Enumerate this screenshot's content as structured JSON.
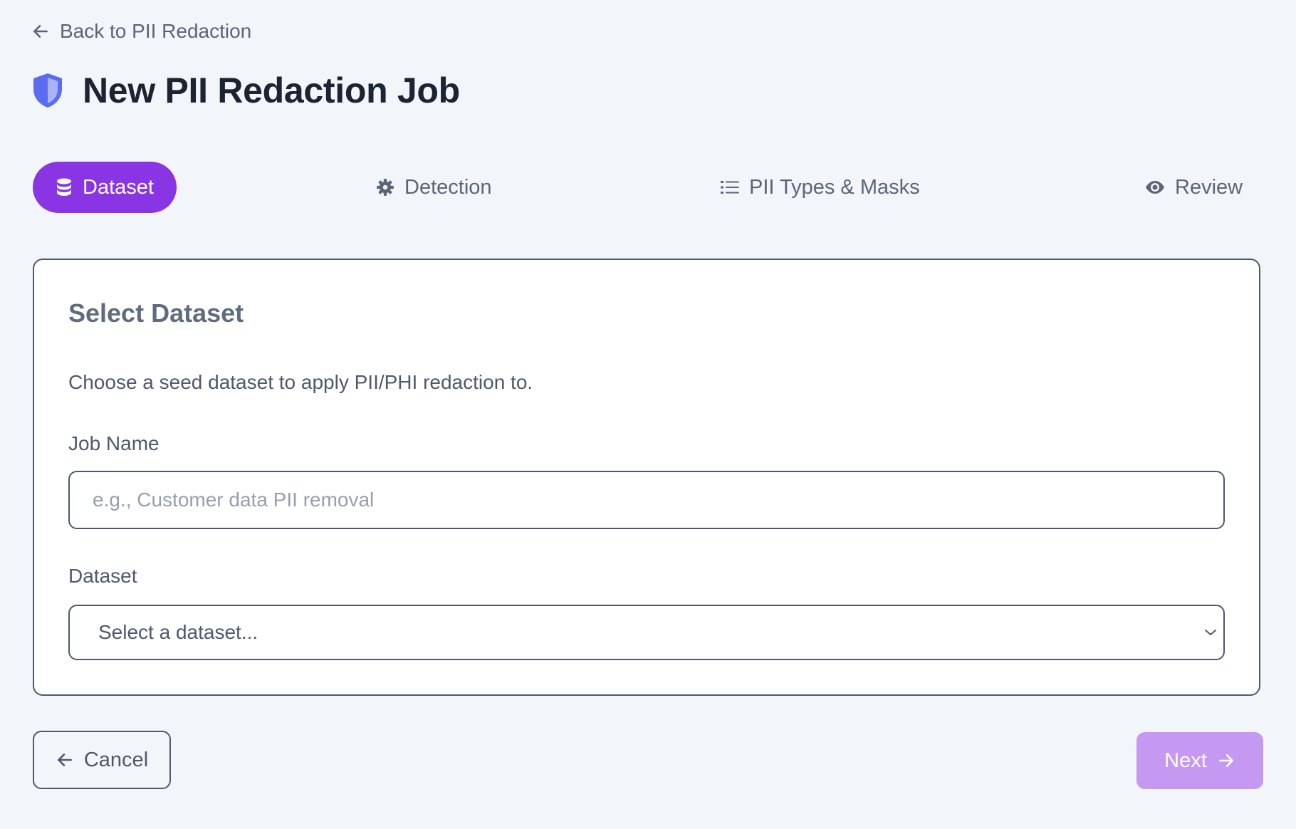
{
  "nav": {
    "back_label": "Back to PII Redaction"
  },
  "header": {
    "title": "New PII Redaction Job",
    "icon": "shield-icon"
  },
  "steps": [
    {
      "label": "Dataset",
      "icon": "database-icon",
      "active": true
    },
    {
      "label": "Detection",
      "icon": "gear-icon",
      "active": false
    },
    {
      "label": "PII Types & Masks",
      "icon": "list-icon",
      "active": false
    },
    {
      "label": "Review",
      "icon": "eye-icon",
      "active": false
    }
  ],
  "card": {
    "title": "Select Dataset",
    "description": "Choose a seed dataset to apply PII/PHI redaction to.",
    "job_name": {
      "label": "Job Name",
      "placeholder": "e.g., Customer data PII removal",
      "value": ""
    },
    "dataset": {
      "label": "Dataset",
      "selected": "Select a dataset..."
    }
  },
  "footer": {
    "cancel_label": "Cancel",
    "next_label": "Next"
  },
  "colors": {
    "accent": "#8a35e3",
    "accent_disabled": "#c599f1",
    "shield": "#5b6cf0",
    "background": "#f2f5fa",
    "text_muted": "#5b6577"
  }
}
